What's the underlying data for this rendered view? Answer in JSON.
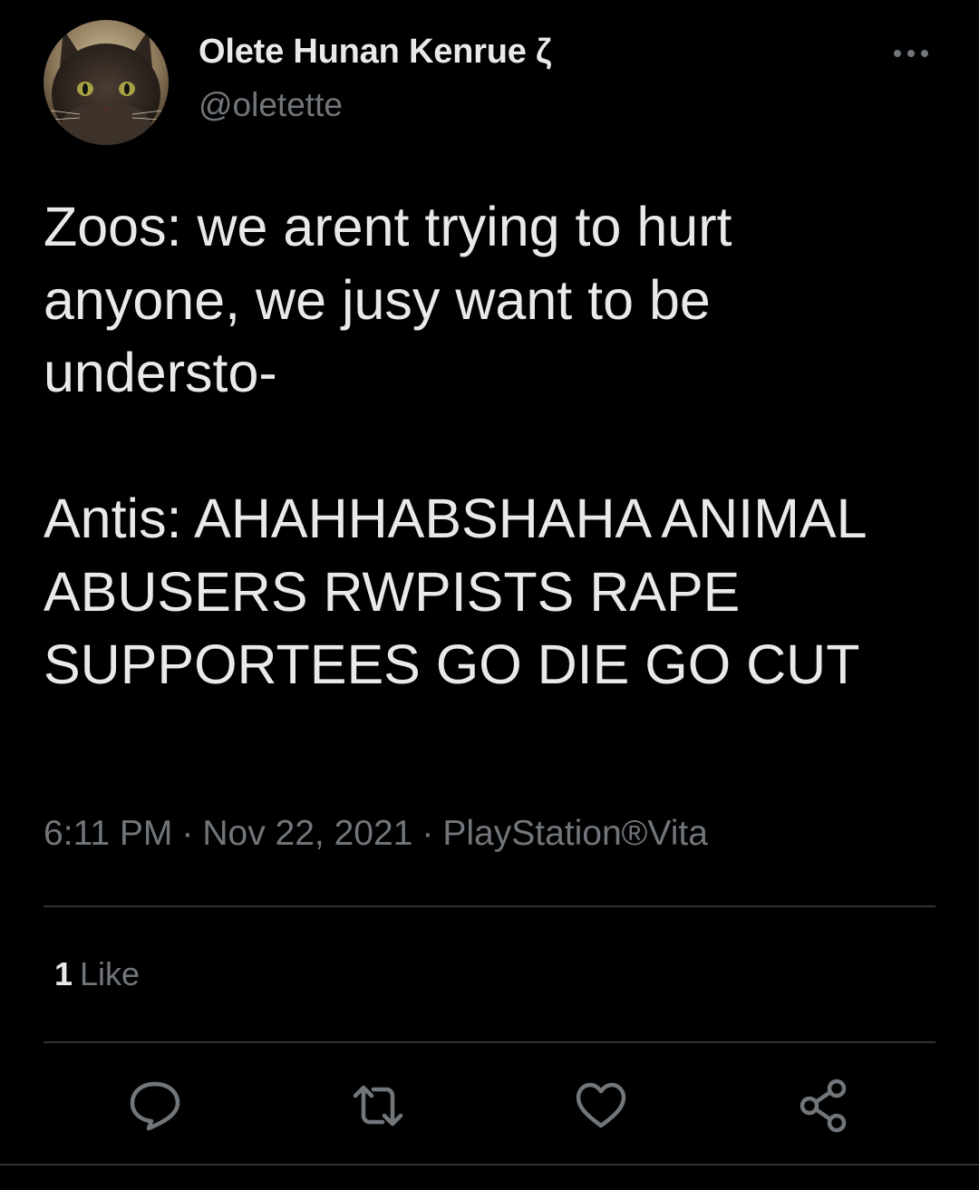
{
  "author": {
    "display_name": "Olete Hunan Kenrue ζ",
    "handle": "@oletette",
    "avatar_icon": "cat-avatar"
  },
  "tweet": {
    "text": "Zoos: we arent trying to hurt anyone, we jusy want to be understo-\n\nAntis: AHAHHABSHAHA ANIMAL ABUSERS RWPISTS RAPE SUPPORTEES GO DIE GO CUT",
    "time": "6:11 PM",
    "date": "Nov 22, 2021",
    "source": "PlayStation®Vita"
  },
  "stats": {
    "likes_count": "1",
    "likes_label": "Like"
  },
  "actions": {
    "reply_icon": "reply-icon",
    "retweet_icon": "retweet-icon",
    "like_icon": "heart-icon",
    "share_icon": "share-icon",
    "more_icon": "more-icon"
  },
  "colors": {
    "background": "#000000",
    "primary_text": "#e7e9ea",
    "secondary_text": "#71767b",
    "divider": "#2f3336"
  }
}
